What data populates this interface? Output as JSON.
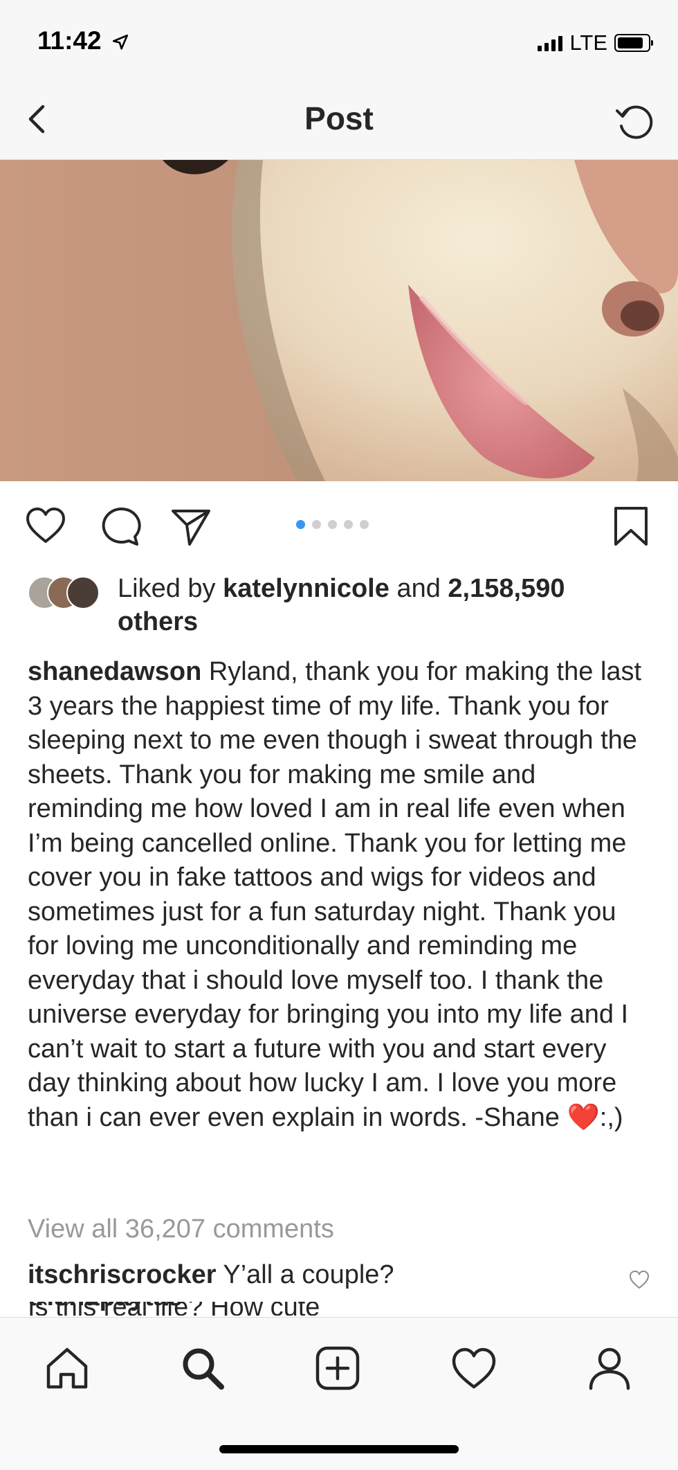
{
  "status_bar": {
    "time": "11:42",
    "network": "LTE"
  },
  "nav": {
    "title": "Post"
  },
  "carousel": {
    "total": 5,
    "active_index": 0
  },
  "likes": {
    "prefix": "Liked by",
    "user": "katelynnicole",
    "conjunction": "and",
    "count": "2,158,590",
    "suffix": "others"
  },
  "caption": {
    "username": "shanedawson",
    "text": "Ryland, thank you for making the last 3 years the happiest time of my life. Thank you for sleeping next to me even though i sweat through the sheets. Thank you for making me smile and reminding me how loved I am in real life even when I’m being cancelled online. Thank you for letting me cover you in fake tattoos and wigs for videos and sometimes just for a fun saturday night. Thank you for loving me unconditionally and reminding me everyday that i should love myself too. I thank the universe everyday for bringing you into my life and I can’t wait to start a future with you and start every day thinking about how lucky I am. I love you more than i can ever even explain in words. -Shane",
    "emoji": "❤️",
    "ending": ":,)"
  },
  "comments": {
    "view_all": "View all 36,207 comments",
    "first": {
      "username": "itschriscrocker",
      "text": "Y’all a couple?"
    },
    "second_peek": {
      "username": "trishapaytas",
      "text": "Is this real life? How cute"
    }
  },
  "tab_bar": {
    "items": [
      "home-icon",
      "search-icon",
      "new-post-icon",
      "activity-icon",
      "profile-icon"
    ]
  },
  "colors": {
    "accent_blue": "#3897f0",
    "emoji_red": "#e0161d",
    "muted_text": "#999999"
  }
}
